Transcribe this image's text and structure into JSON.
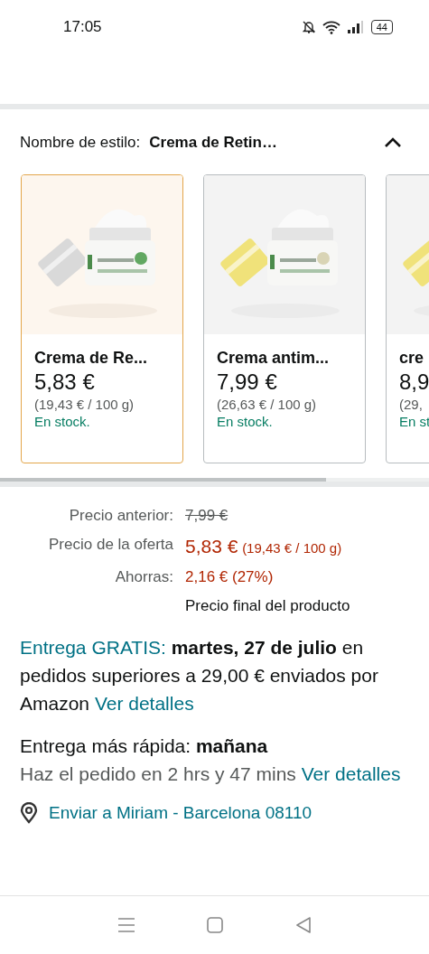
{
  "status_bar": {
    "time": "17:05",
    "battery": "44"
  },
  "style_selector": {
    "label": "Nombre de estilo:",
    "value": "Crema de Retin…",
    "expanded": true
  },
  "variants": [
    {
      "name": "Crema de Re...",
      "price": "5,83 €",
      "unit_price": "(19,43 € / 100 g)",
      "availability": "En stock.",
      "selected": true,
      "kind": "picture"
    },
    {
      "name": "Crema antim...",
      "price": "7,99 €",
      "unit_price": "(26,63 € / 100 g)",
      "availability": "En stock.",
      "selected": false,
      "kind": "picture"
    },
    {
      "name": "cre",
      "price": "8,9",
      "unit_price": "(29,",
      "availability": "En st",
      "selected": false,
      "kind": "picture"
    }
  ],
  "pricing": [
    {
      "label": "Precio anterior:",
      "value": "7,99 €",
      "kind": "struck"
    },
    {
      "label": "Precio de la oferta",
      "value": "5,83 €",
      "note": "(19,43 € / 100 g)",
      "kind": "deal"
    },
    {
      "label": "Ahorras:",
      "value": "2,16 € (27%)",
      "kind": "saving"
    }
  ],
  "price_note": "Precio final del producto",
  "free_delivery": {
    "label": "Entrega GRATIS:",
    "text": "**martes, 27 de julio** en pedidos superiores a 29,00 € enviados por Amazon",
    "link": "Ver detalles"
  },
  "fast_delivery": {
    "text": "Entrega más rápida: **mañana**",
    "detail": "Haz el pedido en 2 hrs y 47 mins",
    "link": "Ver detalles"
  },
  "ship_to": "Enviar a Miriam - Barcelona 08110"
}
